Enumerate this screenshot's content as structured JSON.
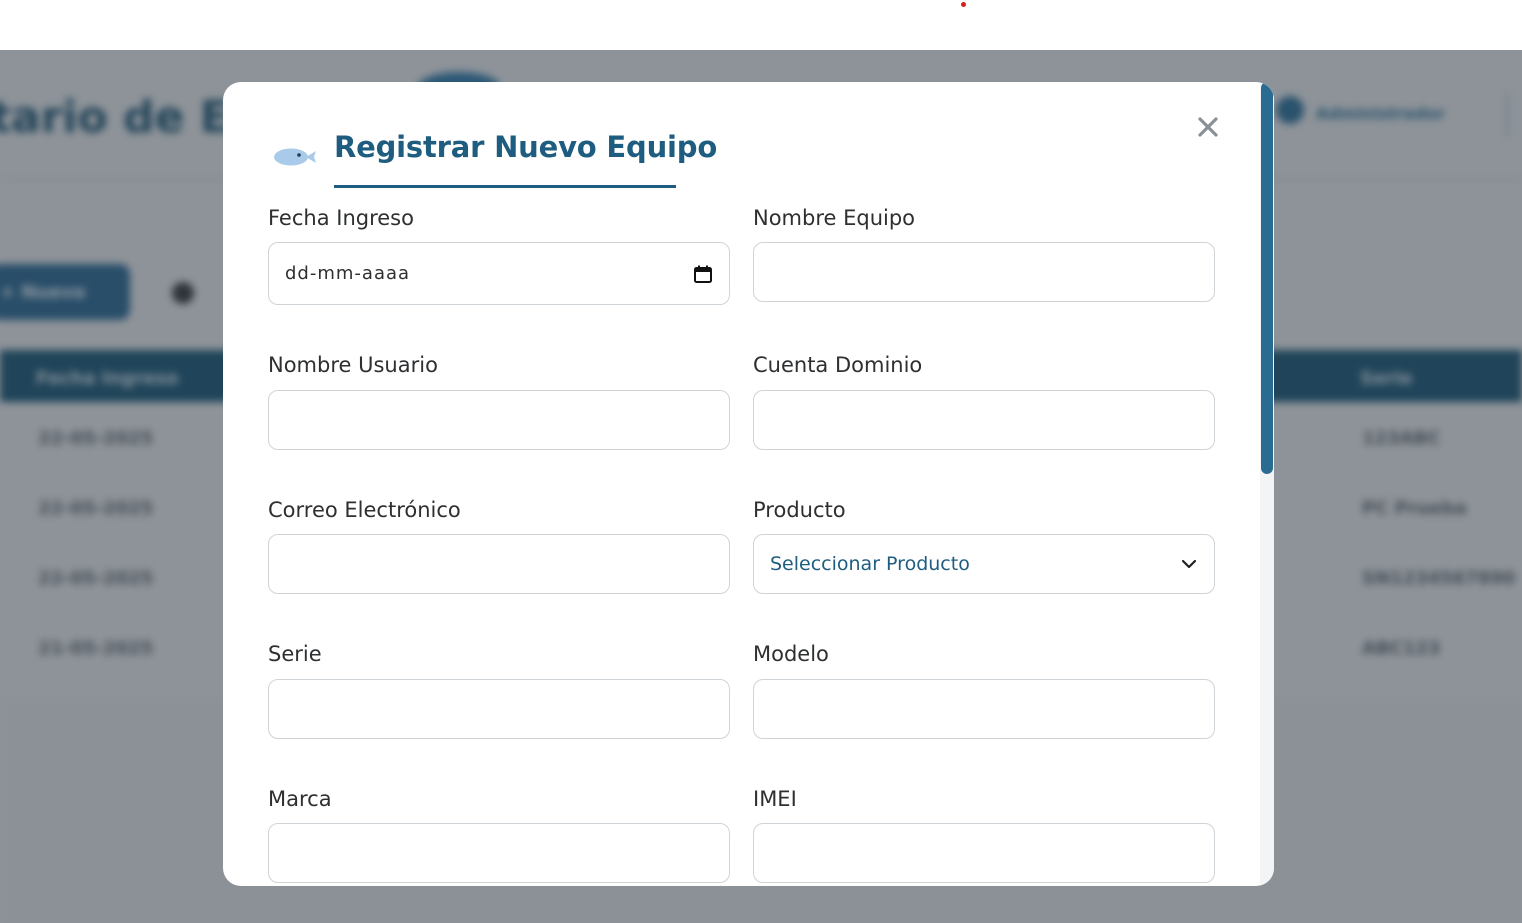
{
  "background": {
    "title_partial": "tario de Eq",
    "user_label": "Administrador",
    "button_label": "+ Nuevo",
    "table": {
      "header_first": "Fecha Ingreso",
      "header_last": "Serie",
      "rows": [
        {
          "date": "22-05-2025",
          "last": "123ABC"
        },
        {
          "date": "22-05-2025",
          "last": "PC Prueba"
        },
        {
          "date": "22-05-2025",
          "last": "SN1234567890"
        },
        {
          "date": "21-05-2025",
          "last": "ABC123"
        }
      ]
    }
  },
  "modal": {
    "title": "Registrar Nuevo Equipo",
    "close_icon": "close-icon",
    "title_icon": "fish-icon",
    "fields": {
      "fecha_ingreso": {
        "label": "Fecha Ingreso",
        "placeholder": "dd-mm-aaaa"
      },
      "nombre_equipo": {
        "label": "Nombre Equipo",
        "value": ""
      },
      "nombre_usuario": {
        "label": "Nombre Usuario",
        "value": ""
      },
      "cuenta_dominio": {
        "label": "Cuenta Dominio",
        "value": ""
      },
      "correo": {
        "label": "Correo Electrónico",
        "value": ""
      },
      "producto": {
        "label": "Producto",
        "selected": "Seleccionar Producto"
      },
      "serie": {
        "label": "Serie",
        "value": ""
      },
      "modelo": {
        "label": "Modelo",
        "value": ""
      },
      "marca": {
        "label": "Marca",
        "value": ""
      },
      "imei": {
        "label": "IMEI",
        "value": ""
      }
    }
  },
  "colors": {
    "accent": "#1f5d80",
    "scrollbar": "#2a6b91",
    "overlay": "rgba(40,46,52,0.42)"
  }
}
